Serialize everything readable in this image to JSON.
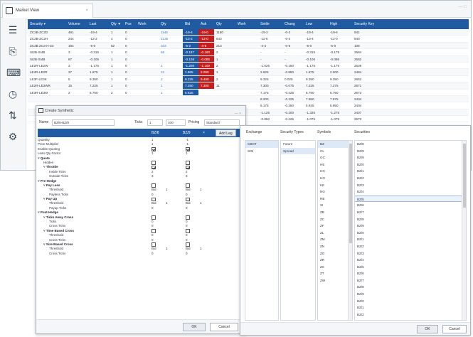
{
  "market_view": {
    "tab_title": "Market View",
    "tab_close": "×",
    "window_controls": "— □",
    "columns": [
      "Security ▾",
      "Volume",
      "Last",
      "Qty ▼",
      "Pos",
      "Work",
      "Qty",
      "Bid",
      "Ask",
      "Qty",
      "Work",
      "Settle",
      "Chang",
      "Low",
      "High",
      "Security Key"
    ],
    "rows": [
      [
        "ZC2B-ZC2D",
        "481",
        "-19-4",
        "1",
        "0",
        "",
        "1145",
        "-19-4",
        "-19-0",
        "1150",
        "",
        "-19-2",
        "-0-2",
        "-19-4",
        "-19-6",
        "941"
      ],
      [
        "ZC2B-ZC2H",
        "244",
        "-12-2",
        "4",
        "0",
        "",
        "2135",
        "-12-2",
        "-12-0",
        "643",
        "",
        "-11-6",
        "-0-4",
        "-13-4",
        "-12-0",
        "940"
      ],
      [
        "ZC3B ZC3-H-Z3",
        "194",
        "-5-0",
        "62",
        "0",
        "",
        "103",
        "-5-2",
        "-4-6",
        "213",
        "",
        "-4-2",
        "-0-6",
        "-5-0",
        "-5-0",
        "108"
      ],
      [
        "SI2B-SI4B",
        "3",
        "-0.315",
        "1",
        "0",
        "",
        "68",
        "-0.187",
        "-0.180",
        "2",
        "",
        "-",
        "-",
        "-0.315",
        "-0.179",
        "2584"
      ],
      [
        "SI2B-SI4B",
        "87",
        "-0.105",
        "1",
        "0",
        "",
        "",
        "-0.108",
        "-0.085",
        "1",
        "",
        "-",
        "-",
        "-0.106",
        "-0.095",
        "2582"
      ],
      [
        "LE2R-LE2W",
        "3",
        "-1.175",
        "1",
        "0",
        "",
        "2",
        "-1.200",
        "-1.100",
        "2",
        "",
        "-1.025",
        "-0.150",
        "-1.175",
        "-1.175",
        "2539"
      ],
      [
        "LE4R-LE2R",
        "37",
        "1.875",
        "1",
        "0",
        "",
        "12",
        "1.865",
        "2.000",
        "1",
        "",
        "2.825",
        "-0.850",
        "1.875",
        "2.000",
        "2484"
      ],
      [
        "LE3F-LE3K",
        "5",
        "9.350",
        "1",
        "0",
        "",
        "2",
        "9.225",
        "9.400",
        "2",
        "",
        "9.325",
        "0.025",
        "9.350",
        "9.350",
        "2652"
      ],
      [
        "LE2R-LE3WR",
        "15",
        "7.225",
        "1",
        "0",
        "",
        "1",
        "7.250",
        "7.300",
        "11",
        "",
        "7.300",
        "-0.075",
        "7.225",
        "7.275",
        "2671"
      ],
      [
        "LE3R-LE3M",
        "2",
        "6.750",
        "2",
        "0",
        "",
        "1",
        "6.625",
        "",
        "",
        "",
        "7.175",
        "-0.425",
        "6.750",
        "6.750",
        "2673"
      ],
      [
        "",
        "",
        "",
        "",
        "",
        "",
        "",
        "",
        "",
        "",
        "",
        "8.200",
        "-0.225",
        "7.950",
        "7.975",
        "2404"
      ],
      [
        "",
        "",
        "",
        "",
        "",
        "",
        "",
        "",
        "",
        "",
        "",
        "6.175",
        "-0.250",
        "5.925",
        "5.950",
        "2404"
      ],
      [
        "",
        "",
        "",
        "",
        "",
        "",
        "",
        "",
        "",
        "",
        "",
        "-1.125",
        "-0.200",
        "-1.325",
        "-1.275",
        "2407"
      ],
      [
        "",
        "",
        "",
        "",
        "",
        "",
        "",
        "",
        "",
        "",
        "",
        "-0.850",
        "-0.225",
        "-1.075",
        "-1.075",
        "2673"
      ]
    ]
  },
  "create_synthetic": {
    "title": "Create Synthetic",
    "window_controls": "— ×",
    "name_label": "Name",
    "name_value": "BZ/8-BZ/9",
    "ticks_label": "Ticks",
    "ticks_value": "1",
    "size_value": "100",
    "pricing_label": "Pricing",
    "pricing_value": "Standard",
    "leg1": "BZ/8",
    "leg2": "BZ/9",
    "add_leg": "Add Leg",
    "remove_leg": "×",
    "props": [
      {
        "label": "Quantity",
        "v1": "1",
        "v2": "-1"
      },
      {
        "label": "Price Multiplier",
        "v1": "1",
        "v2": "-1"
      },
      {
        "label": "Enable Quoting",
        "c1": true,
        "c2": true
      },
      {
        "label": "Lean Qty Factor",
        "v1": "1",
        "v2": "1"
      },
      {
        "label": "˅ Quote",
        "bold": true
      },
      {
        "label": "Hidden",
        "c1": false,
        "c2": false,
        "indent": 8
      },
      {
        "label": "˅ Throttle",
        "c1": true,
        "c2": true,
        "bold": true,
        "indent": 8
      },
      {
        "label": "Inside Ticks",
        "v1": "2",
        "v2": "2",
        "indent": 16
      },
      {
        "label": "Outside Ticks",
        "v1": "3",
        "v2": "3",
        "indent": 16
      },
      {
        "label": "˅ Pre-Hedge",
        "bold": true
      },
      {
        "label": "˅ Pay Less",
        "c1": false,
        "c2": false,
        "bold": true,
        "indent": 8
      },
      {
        "label": "Threshold",
        "v1": "Bid",
        "u1": "1",
        "v2": "Bid",
        "u2": "1",
        "indent": 16
      },
      {
        "label": "Payless Ticks",
        "v1": "0",
        "v2": "0",
        "indent": 16
      },
      {
        "label": "˅ Pay Up",
        "c1": false,
        "c2": false,
        "bold": true,
        "indent": 8
      },
      {
        "label": "Threshold",
        "v1": "Bid",
        "u1": "1",
        "v2": "Bid",
        "u2": "1",
        "indent": 16
      },
      {
        "label": "Payup Ticks",
        "v1": "0",
        "v2": "0",
        "indent": 16
      },
      {
        "label": "˅ Post-Hedge",
        "bold": true
      },
      {
        "label": "˅ Ticks Away Cross",
        "c1": false,
        "c2": false,
        "bold": true,
        "indent": 8
      },
      {
        "label": "Ticks",
        "v1": "0",
        "v2": "0",
        "indent": 16
      },
      {
        "label": "Cross Ticks",
        "v1": "0",
        "v2": "0",
        "indent": 16
      },
      {
        "label": "˅ Time Based Cross",
        "c1": false,
        "c2": false,
        "bold": true,
        "indent": 8
      },
      {
        "label": "Threshold",
        "v1": "0",
        "v2": "0",
        "indent": 16
      },
      {
        "label": "Cross Ticks",
        "v1": "0",
        "v2": "0",
        "indent": 16
      },
      {
        "label": "˅ Size Based Cross",
        "c1": false,
        "c2": false,
        "bold": true,
        "indent": 8
      },
      {
        "label": "Threshold",
        "v1": "Bid",
        "u1": "1",
        "v2": "Bid",
        "u2": "1",
        "indent": 16
      },
      {
        "label": "Cross Ticks",
        "v1": "0",
        "v2": "0",
        "indent": 16
      }
    ],
    "ok": "OK",
    "cancel": "Cancel"
  },
  "security_picker": {
    "headers": {
      "exchange": "Exchange",
      "types": "Security Types",
      "symbols": "Symbols",
      "securities": "Securities"
    },
    "exchanges": [
      "CBOT",
      "SIM"
    ],
    "types": [
      "Future",
      "Spread"
    ],
    "symbols": [
      "BZ",
      "CL",
      "GC",
      "HE",
      "HG",
      "HO",
      "KE",
      "NG",
      "RB",
      "SI",
      "ZB",
      "ZC",
      "ZF",
      "ZL",
      "ZM",
      "ZN",
      "ZO",
      "ZR",
      "ZS",
      "ZT",
      "ZW"
    ],
    "securities": [
      "BZ/8",
      "BZ/9",
      "BZ/9",
      "BZ/0",
      "BZ/1",
      "BZ/2",
      "BZ/3",
      "BZ/4",
      "BZ/5",
      "BZ/6",
      "BZ/7",
      "BZ/8",
      "BZ/9",
      "BZ/0",
      "BZ/1",
      "BZ/2",
      "BZ/3",
      "BZ/4",
      "BZ/5",
      "BZ/6",
      "BZ/7",
      "BZ/8",
      "BZ/9",
      "BZ/0",
      "BZ/1",
      "BZ/2"
    ],
    "ok": "OK",
    "cancel": "Cancel"
  }
}
